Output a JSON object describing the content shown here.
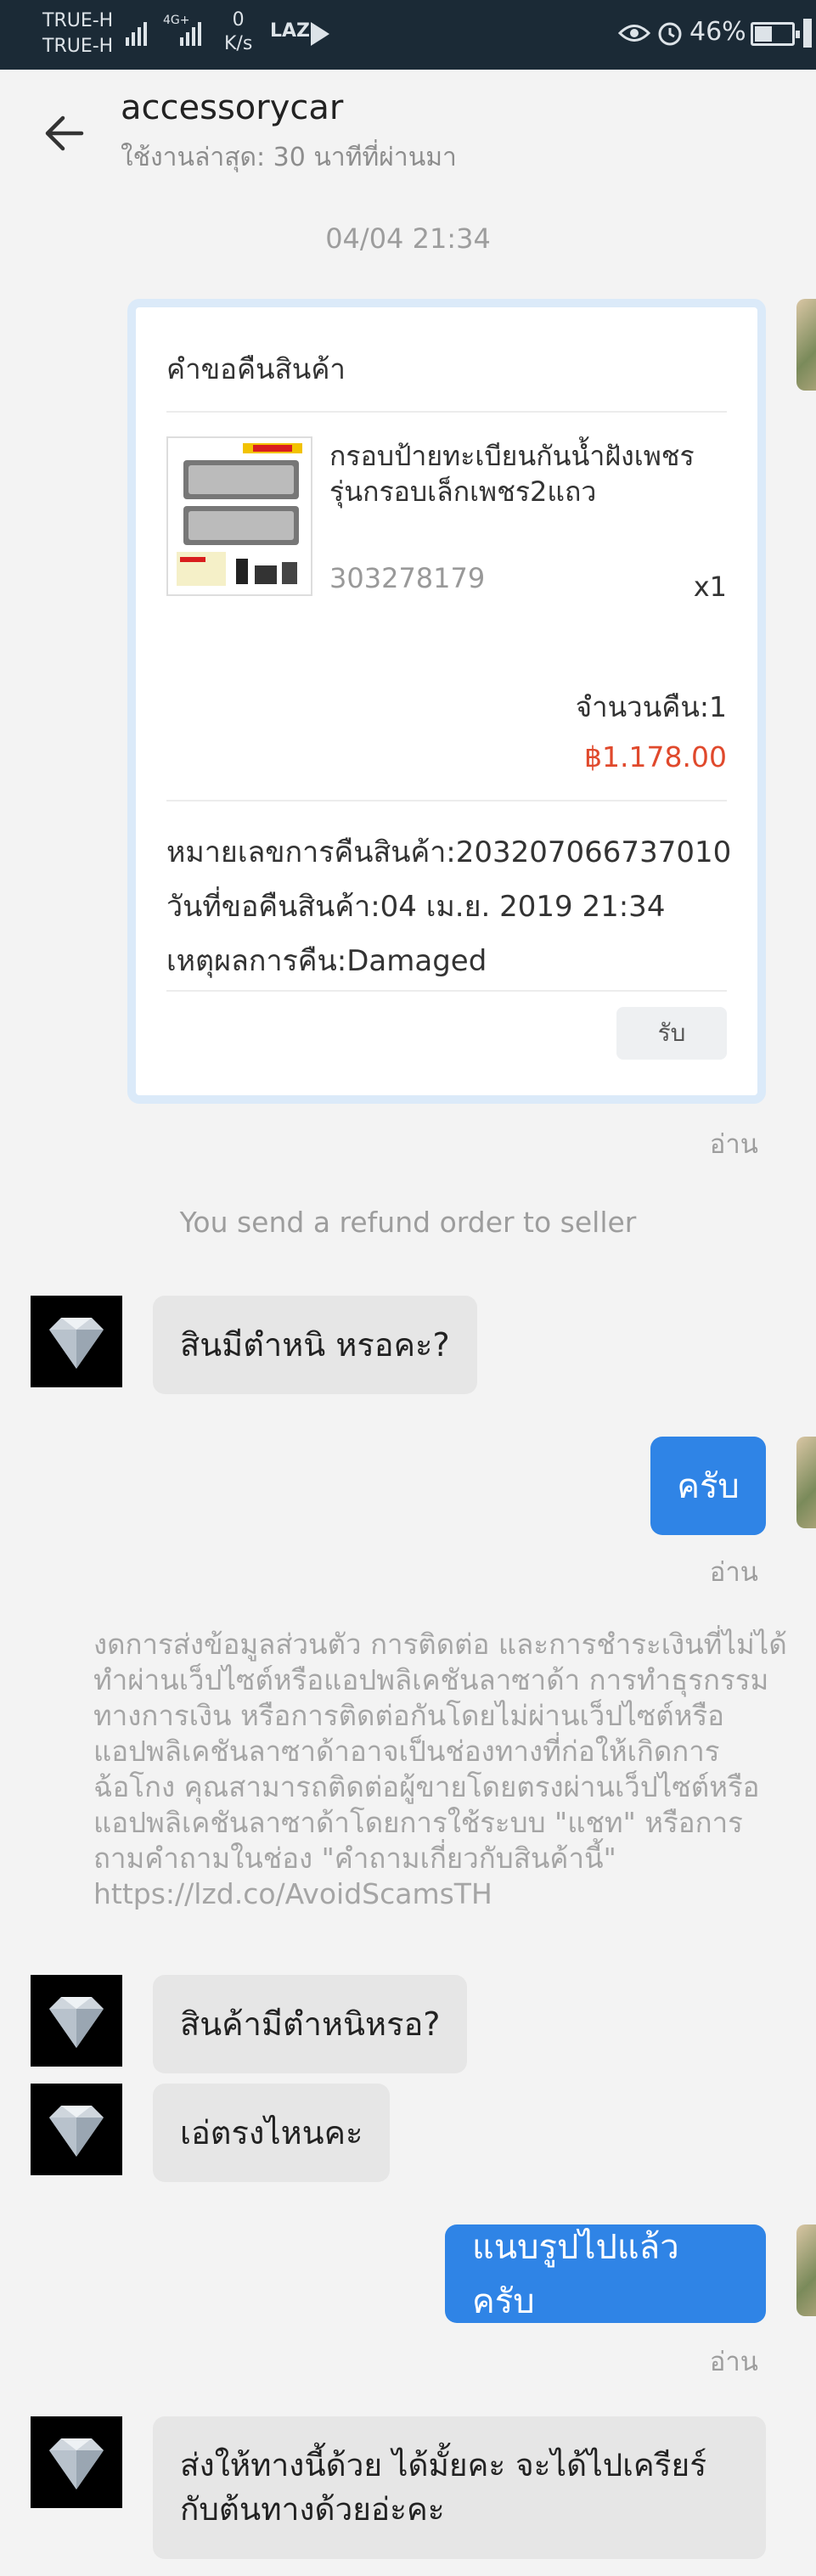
{
  "status_bar": {
    "carrier_1": "TRUE-H",
    "carrier_2": "TRUE-H",
    "network_type": "4G+",
    "speed_value": "0",
    "speed_unit": "K/s",
    "app_badge": "LAZ",
    "battery": "46%"
  },
  "header": {
    "title": "accessorycar",
    "subtitle": "ใช้งานล่าสุด: 30 นาทีที่ผ่านมา"
  },
  "timestamp": "04/04 21:34",
  "refund_card": {
    "title": "คำขอคืนสินค้า",
    "product_name": "กรอบป้ายทะเบียนกันน้ำฝังเพชร รุ่นกรอบเล็กเพชร2แถว",
    "product_sku": "303278179",
    "product_qty": "x1",
    "return_count": "จำนวนคืน:1",
    "return_price": "฿1.178.00",
    "return_number": "หมายเลขการคืนสินค้า:203207066737010",
    "request_date": "วันที่ขอคืนสินค้า:04 เม.ย. 2019 21:34",
    "return_reason": "เหตุผลการคืน:Damaged",
    "receive_label": "รับ"
  },
  "read_label": "อ่าน",
  "system_message": "You send a refund order to seller",
  "messages": [
    {
      "from": "seller",
      "text": "สินมีตำหนิ หรอคะ?"
    },
    {
      "from": "me",
      "text": "ครับ"
    },
    {
      "from": "seller",
      "text": "สินค้ามีตำหนิหรอ?"
    },
    {
      "from": "seller",
      "text": "เอ่ตรงไหนคะ"
    },
    {
      "from": "me",
      "text": "แนบรูปไปแล้วครับ"
    },
    {
      "from": "seller",
      "text": "ส่งให้ทางนี้ด้วย ได้มั้ยคะ จะได้ไปเครียร์กับต้นทางด้วยอ่ะคะ"
    }
  ],
  "notice": "งดการส่งข้อมูลส่วนตัว การติดต่อ และการชำระเงินที่ไม่ได้ทำผ่านเว็ปไซต์หรือแอปพลิเคชันลาซาด้า การทำธุรกรรมทางการเงิน หรือการติดต่อกันโดยไม่ผ่านเว็ปไซต์หรือแอปพลิเคชันลาซาด้าอาจเป็นช่องทางที่ก่อให้เกิดการฉ้อโกง คุณสามารถติดต่อผู้ขายโดยตรงผ่านเว็ปไซต์หรือแอปพลิเคชันลาซาด้าโดยการใช้ระบบ \"แชท\" หรือการถามคำถามในช่อง \"คำถามเกี่ยวกับสินค้านี้\" https://lzd.co/AvoidScamsTH",
  "colors": {
    "accent": "#2f84e6",
    "price": "#e0492c",
    "status_bar": "#1b2a36"
  }
}
